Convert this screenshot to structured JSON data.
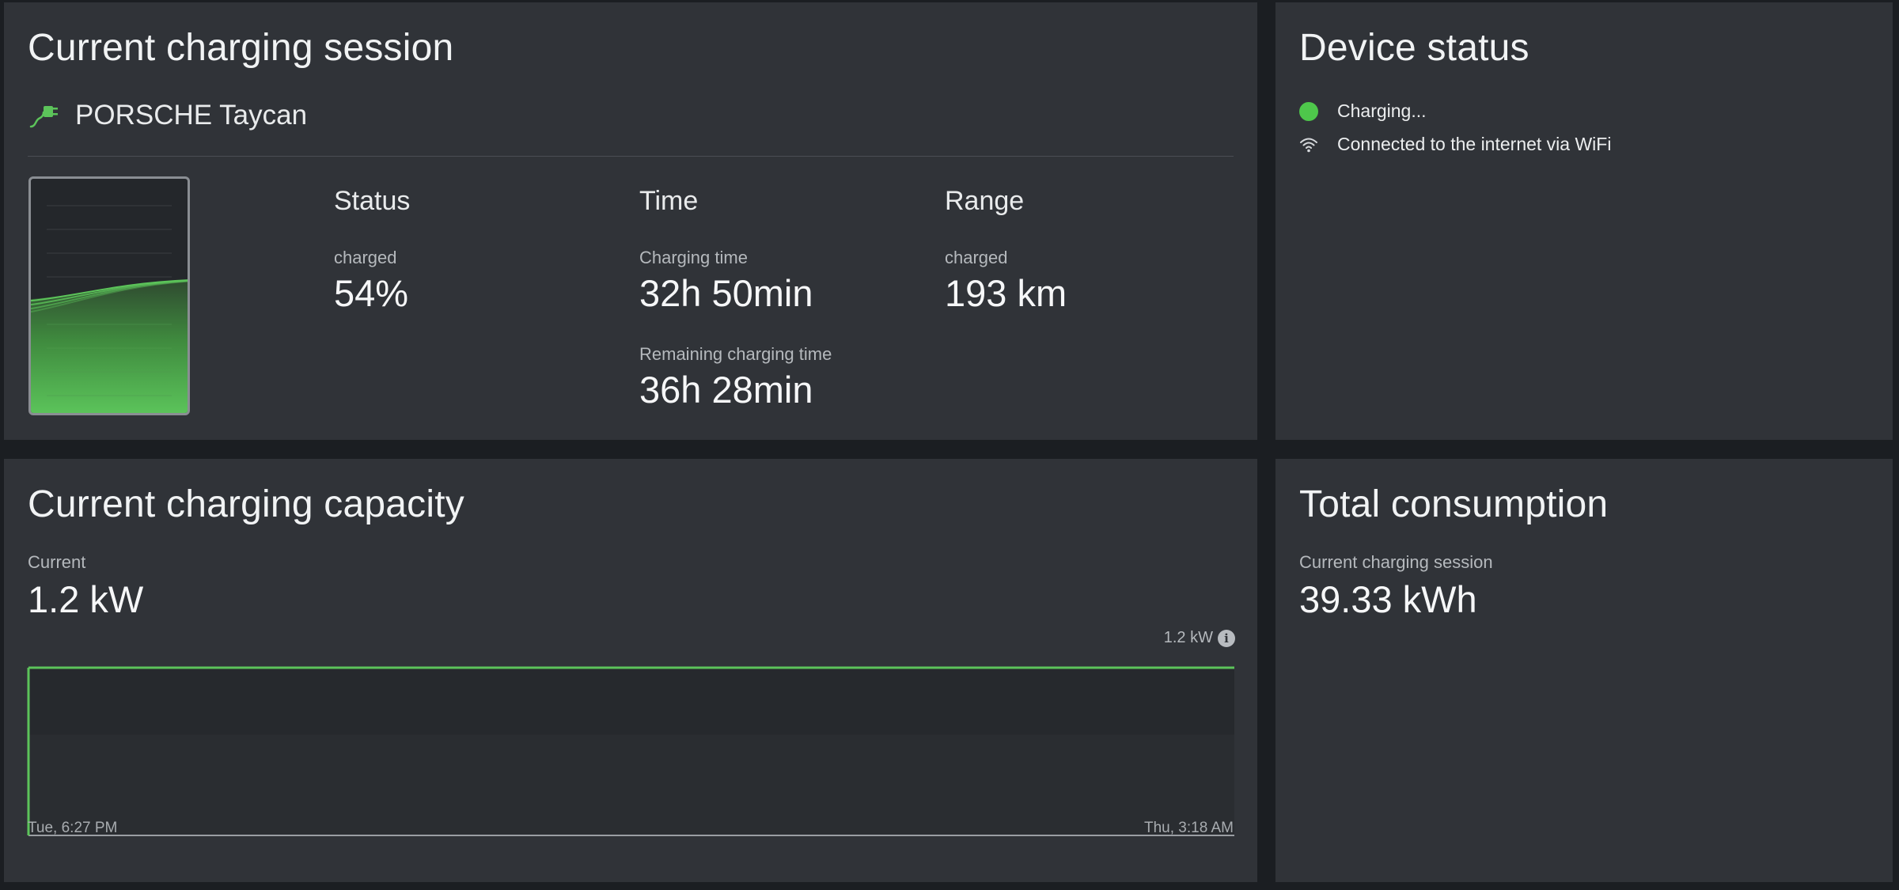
{
  "session": {
    "title": "Current charging session",
    "vehicle": "PORSCHE Taycan",
    "status": {
      "heading": "Status",
      "label": "charged",
      "value": "54%",
      "charge_fraction": 0.54
    },
    "time": {
      "heading": "Time",
      "charging_label": "Charging time",
      "charging_value": "32h 50min",
      "remaining_label": "Remaining charging time",
      "remaining_value": "36h 28min"
    },
    "range": {
      "heading": "Range",
      "label": "charged",
      "value": "193 km"
    }
  },
  "device": {
    "title": "Device status",
    "items": [
      {
        "icon": "status-dot-icon",
        "text": "Charging...",
        "color": "#4ec74b"
      },
      {
        "icon": "wifi-icon",
        "text": "Connected to the internet via WiFi"
      }
    ]
  },
  "capacity": {
    "title": "Current charging capacity",
    "label": "Current",
    "value": "1.2 kW",
    "chart_max_label": "1.2 kW",
    "x_start_label": "Tue, 6:27 PM",
    "x_end_label": "Thu, 3:18 AM"
  },
  "total": {
    "title": "Total consumption",
    "label": "Current charging session",
    "value": "39.33 kWh"
  },
  "colors": {
    "accent_green": "#5cc45a",
    "panel_bg": "#303338",
    "page_bg": "#1b1e22"
  },
  "chart_data": {
    "type": "line",
    "title": "",
    "xlabel": "",
    "ylabel": "",
    "x": [
      "Tue, 6:27 PM",
      "Thu, 3:18 AM"
    ],
    "series": [
      {
        "values": [
          1.2,
          1.2
        ]
      }
    ],
    "ylim": [
      0,
      1.2
    ],
    "grid": false
  }
}
